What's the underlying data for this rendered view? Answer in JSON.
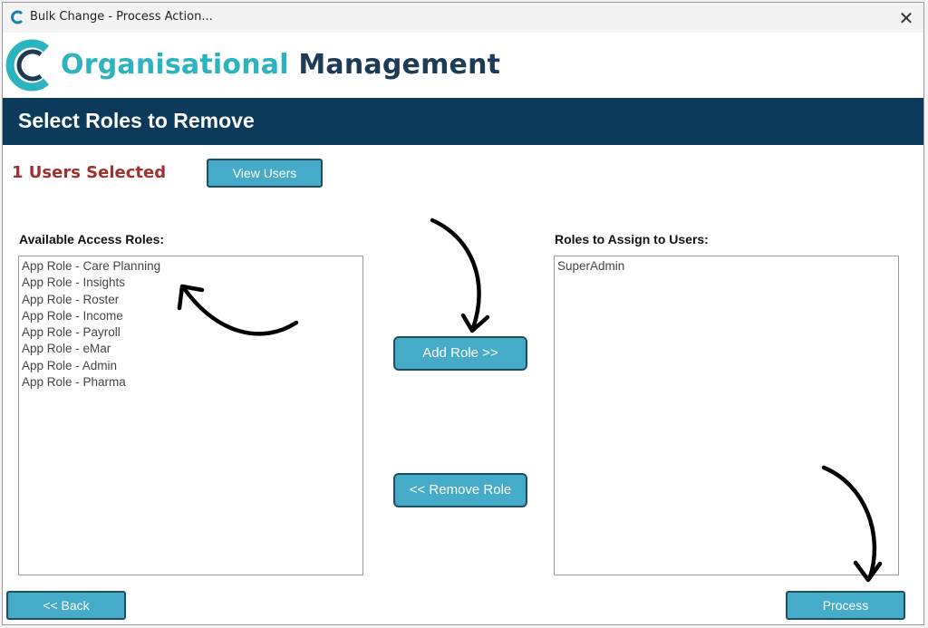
{
  "window": {
    "title": "Bulk Change - Process Action..."
  },
  "logo": {
    "part1": "Organisational",
    "part2": "Management",
    "color_primary": "#2bb3c0",
    "color_secondary": "#1c3b57"
  },
  "banner": {
    "title": "Select Roles to Remove",
    "color": "#0c3a5b"
  },
  "users_selected": "1 Users Selected",
  "buttons": {
    "view_users": "View Users",
    "add_role": "Add Role >>",
    "remove_role": "<< Remove Role",
    "back": "<< Back",
    "process": "Process",
    "color": "#46abc8"
  },
  "available": {
    "label": "Available Access Roles:",
    "items": [
      "App Role - Care Planning",
      "App Role - Insights",
      "App Role - Roster",
      "App Role - Income",
      "App Role - Payroll",
      "App Role - eMar",
      "App Role - Admin",
      "App Role - Pharma"
    ]
  },
  "assign": {
    "label": "Roles to Assign to Users:",
    "items": [
      "SuperAdmin"
    ]
  },
  "icons": {
    "close": "close-icon",
    "app": "app-logo-icon"
  }
}
